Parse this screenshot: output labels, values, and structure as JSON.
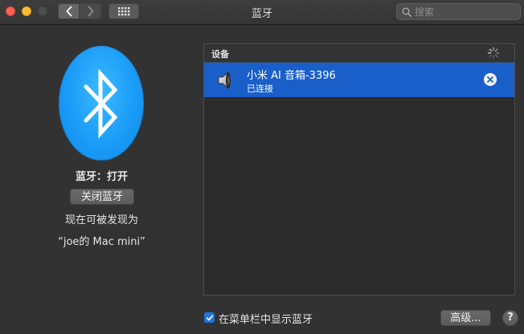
{
  "window": {
    "title": "蓝牙"
  },
  "toolbar": {
    "back_icon": "chevron-left-icon",
    "forward_icon": "chevron-right-icon",
    "grid_icon": "grid-icon"
  },
  "search": {
    "placeholder": "搜索",
    "value": ""
  },
  "bluetooth": {
    "status": "蓝牙：打开",
    "toggle_label": "关闭蓝牙",
    "discoverable_line1": "现在可被发现为",
    "discoverable_line2": "“joe的 Mac mini”",
    "logo_color": "#1a9cf7"
  },
  "devices": {
    "header": "设备",
    "items": [
      {
        "name": "小米 AI 音箱-3396",
        "status": "已连接",
        "icon": "speaker-icon",
        "selected": true
      }
    ],
    "selection_color": "#1a5fc9"
  },
  "footer": {
    "show_in_menubar_label": "在菜单栏中显示蓝牙",
    "show_in_menubar_checked": true,
    "advanced_label": "高级...",
    "help_label": "?"
  }
}
